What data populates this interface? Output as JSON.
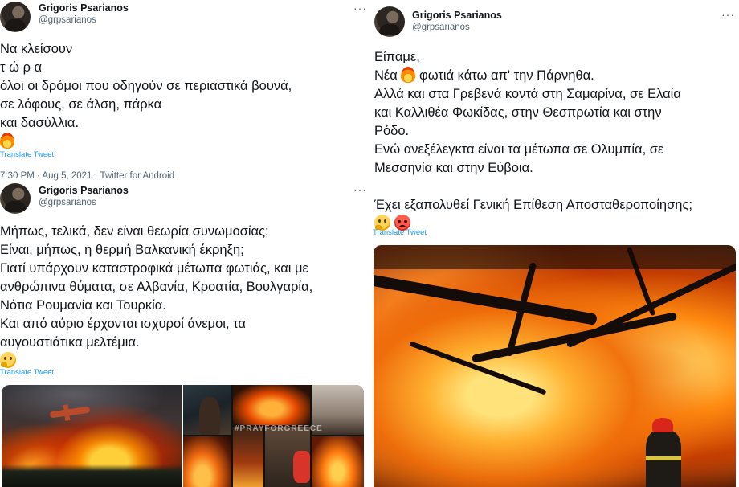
{
  "tweet1": {
    "author_name": "Grigoris Psarianos",
    "author_handle": "@grpsarianos",
    "more_label": "···",
    "lines": [
      "Να κλείσουν",
      "τ ώ ρ α",
      "όλοι οι δρόμοι που οδηγούν σε περιαστικά βουνά,",
      "σε λόφους, σε άλση, πάρκα",
      "και δασύλλια."
    ],
    "emoji": "fire-emoji",
    "translate_label": "Translate Tweet",
    "meta": "7:30 PM · Aug 5, 2021 · Twitter for Android"
  },
  "tweet2": {
    "author_name": "Grigoris Psarianos",
    "author_handle": "@grpsarianos",
    "more_label": "···",
    "lines": [
      "Μήπως, τελικά, δεν είναι θεωρία συνωμοσίας;",
      "Είναι, μήπως, η θερμή Βαλκανική έκρηξη;",
      "Γιατί υπάρχουν καταστροφικά μέτωπα φωτιάς, και με",
      "ανθρώπινα θύματα, σε Αλβανία, Κροατία, Βουλγαρία,",
      "Νότια Ρουμανία και Τουρκία.",
      "Και από αύριο έρχονται ισχυροί άνεμοι, τα",
      "αυγουστιάτικα μελτέμια."
    ],
    "emoji": "thinking-face-emoji",
    "translate_label": "Translate Tweet",
    "image_watermark": "#PRAYFORGREECE"
  },
  "tweet3": {
    "author_name": "Grigoris Psarianos",
    "author_handle": "@grpsarianos",
    "more_label": "···",
    "line1": "Είπαμε,",
    "line2_before": "Νέα",
    "line2_after": "φωτιά κάτω απ' την Πάρνηθα.",
    "lines": [
      "Αλλά και στα Γρεβενά κοντά στη Σαμαρίνα, σε Ελαία",
      "και Καλλιθέα Φωκίδας, στην Θεσπρωτία και στην",
      "Ρόδο.",
      "Ενώ ανεξέλεγκτα είναι τα μέτωπα σε Ολυμπία, σε",
      "Μεσσηνία και στην Εύβοια."
    ],
    "question_line": "Έχει εξαπολυθεί Γενική Επίθεση Αποσταθεροποίησης;",
    "emojis": [
      "thinking-face-emoji",
      "angry-face-emoji"
    ],
    "translate_label": "Translate Tweet"
  }
}
